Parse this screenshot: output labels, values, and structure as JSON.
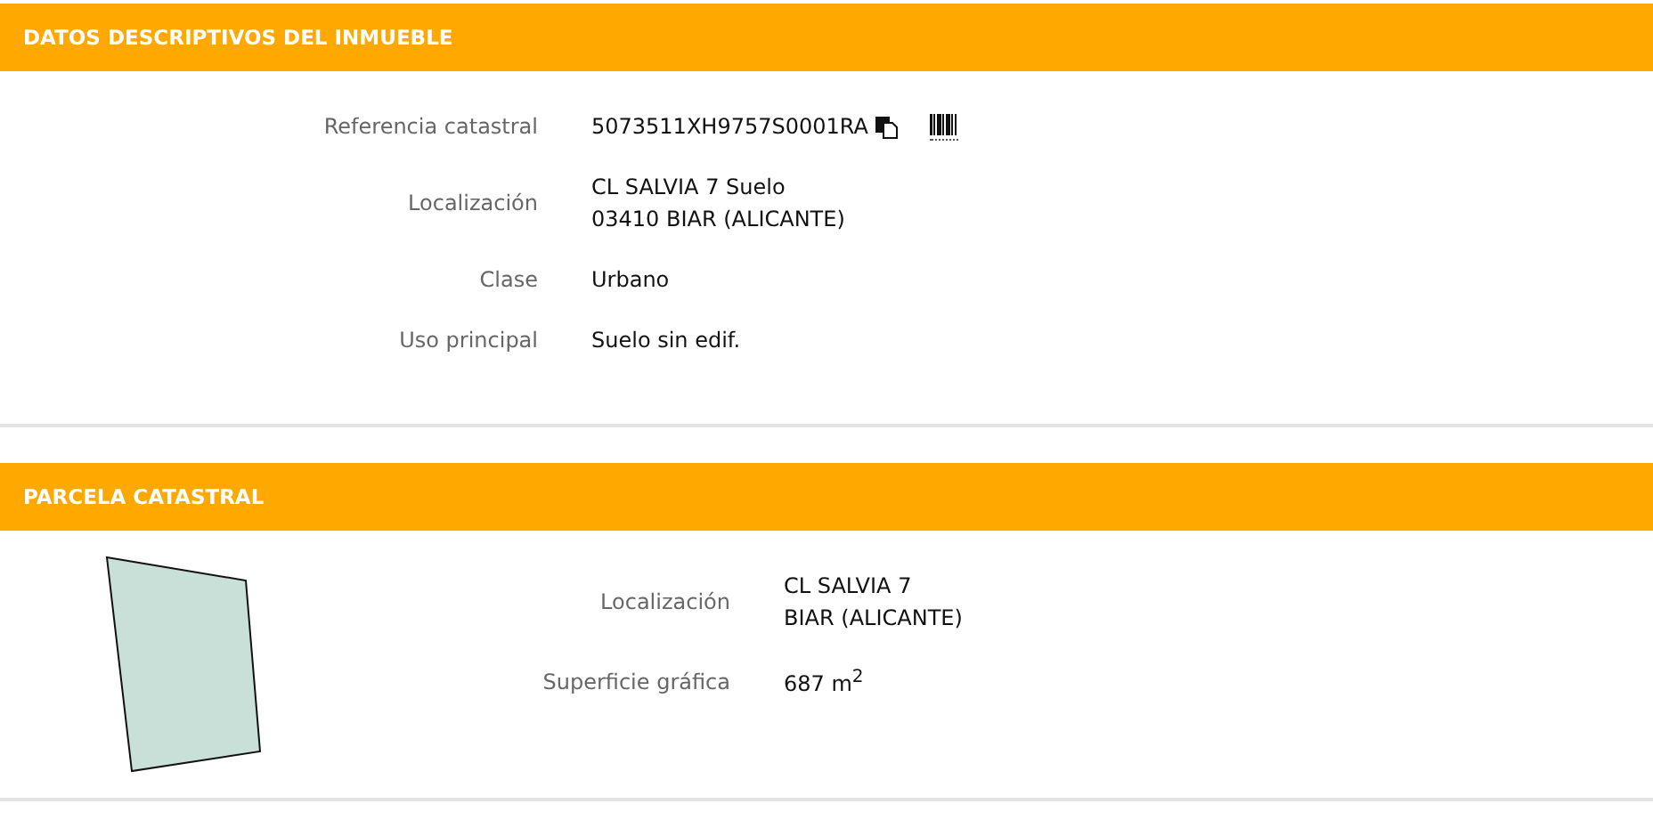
{
  "sections": [
    {
      "title": "DATOS DESCRIPTIVOS DEL INMUEBLE",
      "kind": "fields",
      "fields": [
        {
          "label": "Referencia catastral",
          "lines": [
            "5073511XH9757S0001RA"
          ],
          "kind": "reference"
        },
        {
          "label": "Localización",
          "lines": [
            "CL SALVIA 7 Suelo",
            "03410 BIAR (ALICANTE)"
          ],
          "kind": "text"
        },
        {
          "label": "Clase",
          "lines": [
            "Urbano"
          ],
          "kind": "text"
        },
        {
          "label": "Uso principal",
          "lines": [
            "Suelo sin edif."
          ],
          "kind": "text"
        }
      ]
    },
    {
      "title": "PARCELA CATASTRAL",
      "kind": "parcel",
      "fields": [
        {
          "label": "Localización",
          "lines": [
            "CL SALVIA 7",
            "BIAR (ALICANTE)"
          ],
          "kind": "text"
        },
        {
          "label": "Superficie gráfica",
          "lines": [
            "687 m$^{2}$"
          ],
          "kind": "text"
        }
      ]
    }
  ]
}
